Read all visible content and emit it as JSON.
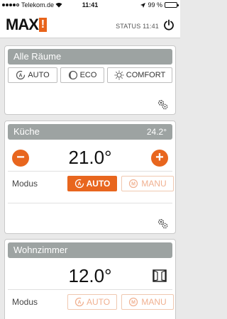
{
  "statusbar": {
    "carrier": "Telekom.de",
    "time": "11:41",
    "battery": "99 %"
  },
  "header": {
    "logo": "MAX",
    "logo_mark": "!",
    "status": "STATUS 11:41"
  },
  "all_rooms": {
    "title": "Alle Räume",
    "modes": [
      {
        "label": "AUTO"
      },
      {
        "label": "ECO"
      },
      {
        "label": "COMFORT"
      }
    ]
  },
  "kitchen": {
    "title": "Küche",
    "current_temp": "24.2°",
    "setpoint": "21.0°",
    "minus": "−",
    "plus": "+",
    "mode_label": "Modus",
    "auto_label": "AUTO",
    "manu_label": "MANU",
    "active_mode": "auto"
  },
  "living": {
    "title": "Wohnzimmer",
    "setpoint": "12.0°",
    "mode_label": "Modus",
    "auto_label": "AUTO",
    "manu_label": "MANU"
  },
  "colors": {
    "accent": "#e8661e",
    "title_bar": "#9da3a2"
  }
}
